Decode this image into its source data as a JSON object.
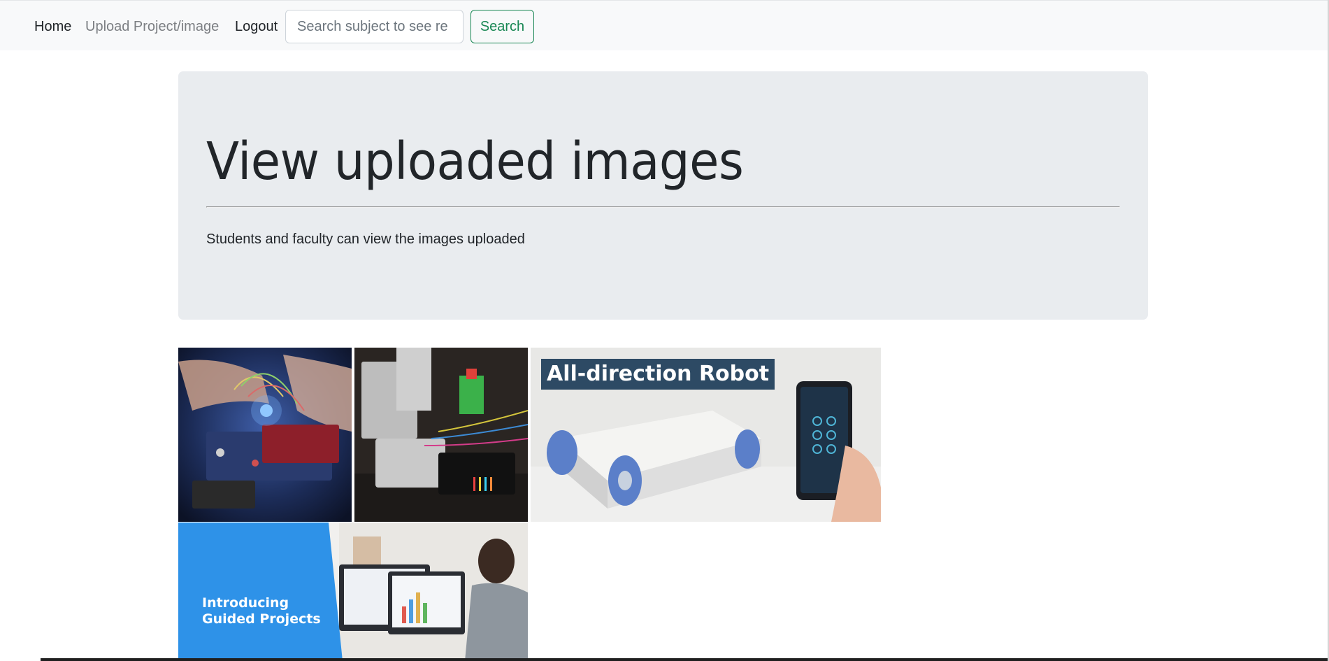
{
  "navbar": {
    "home_label": "Home",
    "upload_label": "Upload Project/image",
    "logout_label": "Logout",
    "search_placeholder": "Search subject to see re",
    "search_button_label": "Search"
  },
  "jumbotron": {
    "title": "View uploaded images",
    "lead": "Students and faculty can view the images uploaded"
  },
  "gallery": {
    "images": [
      {
        "description": "hands-wiring-breadboard-photo"
      },
      {
        "description": "electronics-components-photo"
      },
      {
        "banner_text": "All-direction Robot"
      },
      {
        "text_line_1": "Introducing",
        "text_line_2": "Guided Projects"
      }
    ]
  },
  "colors": {
    "navbar_bg": "#f8f9fa",
    "jumbotron_bg": "#e9ecef",
    "search_button": "#198754",
    "muted_link": "#7c7f83"
  }
}
